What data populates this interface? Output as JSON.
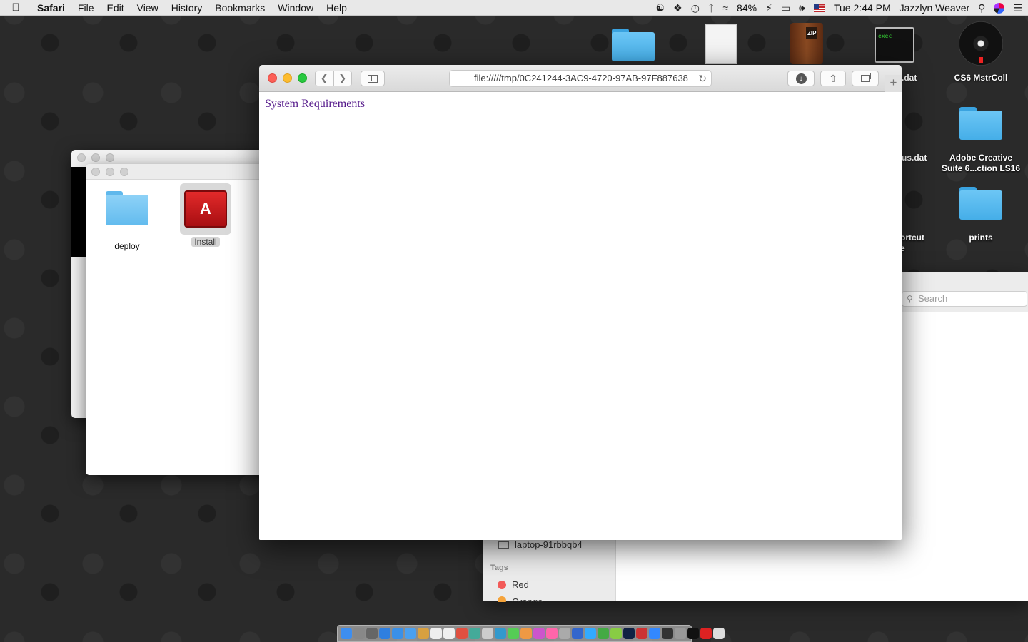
{
  "menubar": {
    "apple": "",
    "app": "Safari",
    "items": [
      "File",
      "Edit",
      "View",
      "History",
      "Bookmarks",
      "Window",
      "Help"
    ],
    "battery": "84%",
    "clock": "Tue 2:44 PM",
    "user": "Jazzlyn Weaver"
  },
  "desktop": {
    "exec_text": "exec",
    "labels": {
      "dat1": ".dat",
      "cs6": "CS6 MstrColl",
      "usdat": "us.dat",
      "adobe": "Adobe Creative Suite 6...ction LS16",
      "shortcut": "ortcut\ne",
      "prints": "prints"
    }
  },
  "finder": {
    "items": [
      {
        "label": "deploy"
      },
      {
        "label": "Install"
      }
    ]
  },
  "right_window": {
    "search_placeholder": "Search",
    "device": "laptop-91rbbqb4",
    "tags_heading": "Tags",
    "tags": [
      {
        "label": "Red",
        "color": "#f25a58"
      },
      {
        "label": "Orange",
        "color": "#f5a33a"
      }
    ]
  },
  "safari": {
    "url": "file://///tmp/0C241244-3AC9-4720-97AB-97F887638",
    "new_tab": "+",
    "link_text": "System Requirements"
  },
  "colors": {
    "link_visited": "#551a8b",
    "close": "#fc5f57",
    "minimize": "#fdbc2e",
    "maximize": "#28c840"
  }
}
